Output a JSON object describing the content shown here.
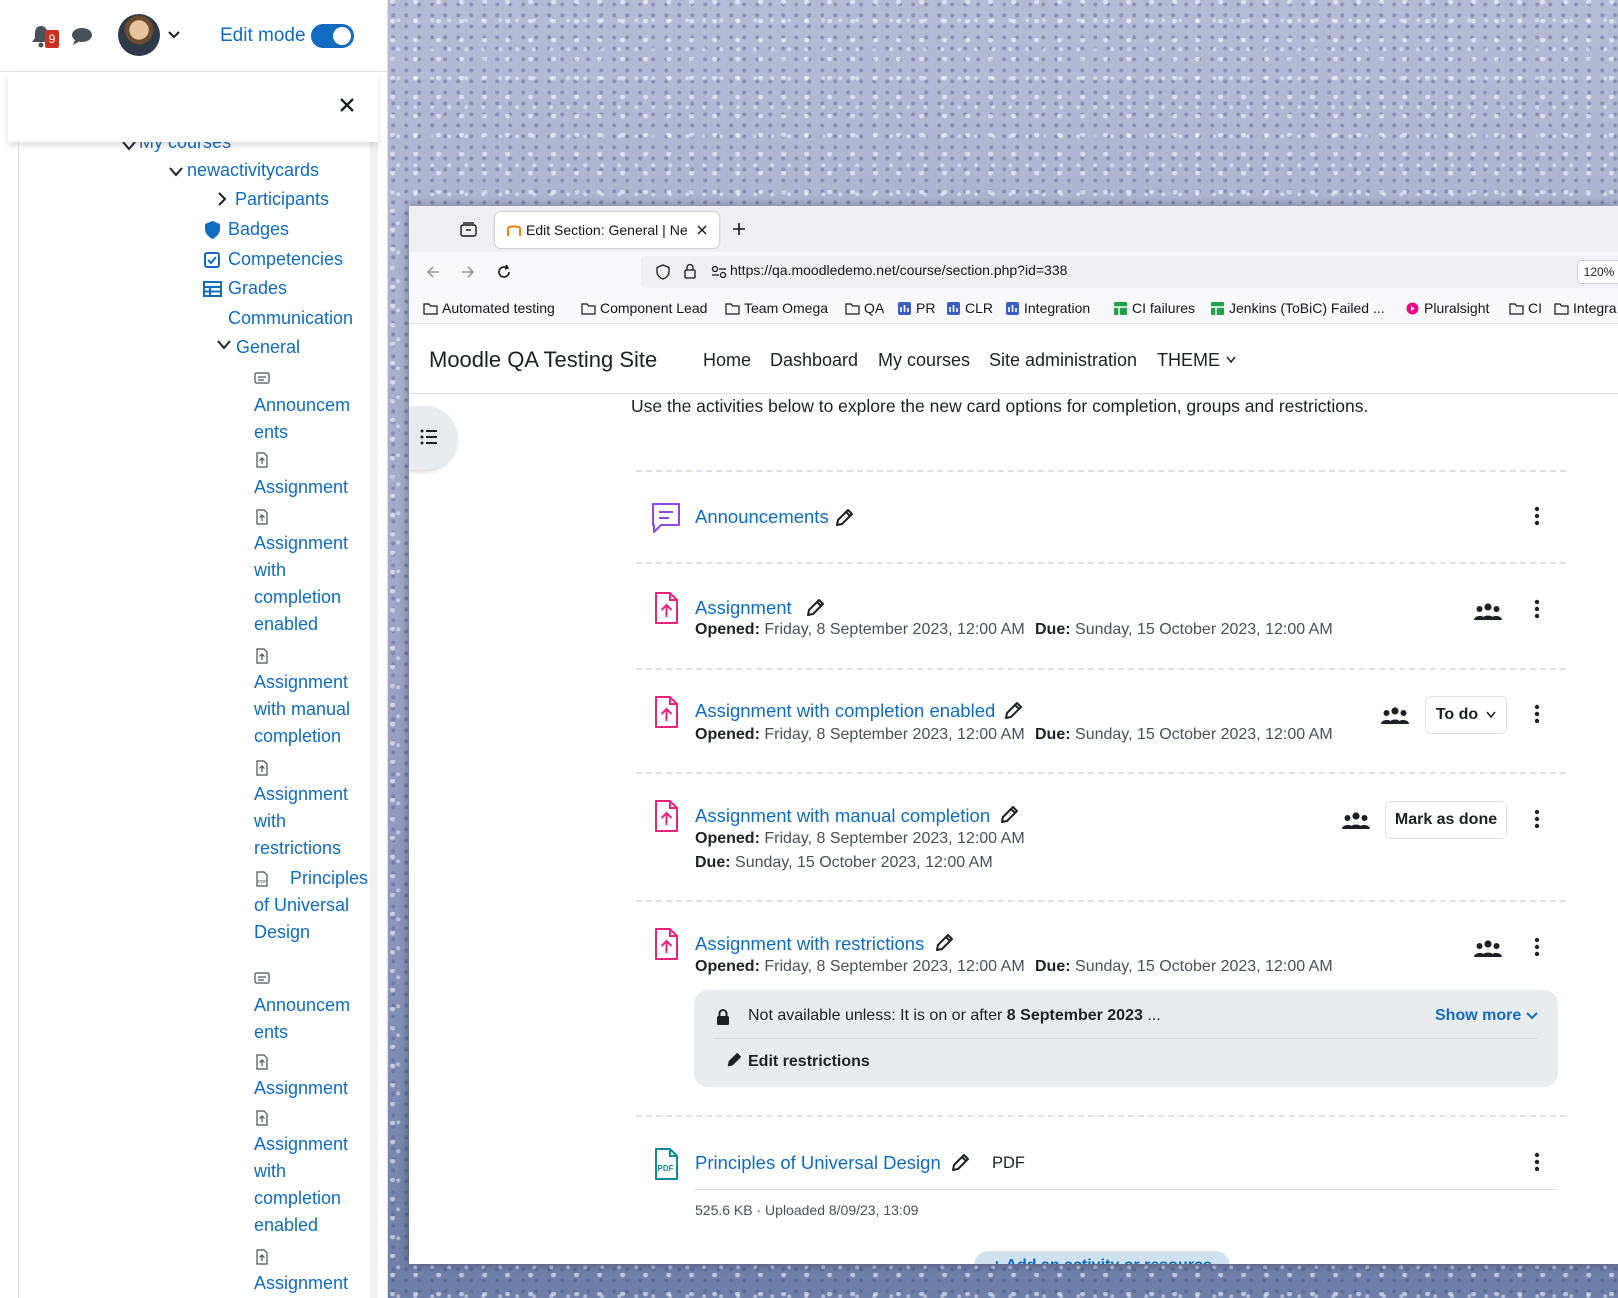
{
  "user_bar": {
    "notification_count": "9",
    "edit_mode_label": "Edit mode",
    "edit_mode_on": true
  },
  "course_index": {
    "my_courses": "My courses",
    "course": "newactivitycards",
    "participants": "Participants",
    "badges": "Badges",
    "competencies": "Competencies",
    "grades": "Grades",
    "communication": "Communication",
    "section_general": "General",
    "items": [
      "Announcem ents",
      "Assignment",
      "Assignment with completion enabled",
      "Assignment with manual completion",
      "Assignment with restrictions",
      "Principles of Universal Design",
      "Announcem ents",
      "Assignment",
      "Assignment with completion enabled",
      "Assignment"
    ]
  },
  "browser": {
    "tab_title": "Edit Section: General | Ne",
    "url": "https://qa.moodledemo.net/course/section.php?id=338",
    "zoom": "120%",
    "bookmarks": [
      "Automated testing",
      "Component Lead",
      "Team Omega",
      "QA",
      "PR",
      "CLR",
      "Integration",
      "CI failures",
      "Jenkins (ToBiC) Failed ...",
      "Pluralsight",
      "CI",
      "Integra"
    ]
  },
  "moodle": {
    "site_name": "Moodle QA Testing Site",
    "menu": [
      "Home",
      "Dashboard",
      "My courses",
      "Site administration",
      "THEME"
    ],
    "intro": "Use the activities below to explore the new card options for completion, groups and restrictions.",
    "labels": {
      "opened": "Opened:",
      "due": "Due:"
    },
    "activities": [
      {
        "title": "Announcements"
      },
      {
        "title": "Assignment",
        "opened": "Friday, 8 September 2023, 12:00 AM",
        "due": "Sunday, 15 October 2023, 12:00 AM"
      },
      {
        "title": "Assignment with completion enabled",
        "opened": "Friday, 8 September 2023, 12:00 AM",
        "due": "Sunday, 15 October 2023, 12:00 AM",
        "completion_button": "To do"
      },
      {
        "title": "Assignment with manual completion",
        "opened": "Friday, 8 September 2023, 12:00 AM",
        "due": "Sunday, 15 October 2023, 12:00 AM",
        "completion_button": "Mark as done"
      },
      {
        "title": "Assignment with restrictions",
        "opened": "Friday, 8 September 2023, 12:00 AM",
        "due": "Sunday, 15 October 2023, 12:00 AM"
      },
      {
        "title": "Principles of Universal Design",
        "type": "PDF",
        "file_meta": "525.6 KB · Uploaded 8/09/23, 13:09"
      }
    ],
    "restriction": {
      "prefix": "Not available unless: It is on or after ",
      "date": "8 September 2023",
      "suffix": " ...",
      "show_more": "Show more",
      "edit": "Edit restrictions"
    },
    "add_activity": "+ Add an activity or resource"
  },
  "colors": {
    "link": "#0f6cbf",
    "assignment_icon": "#e8247a",
    "forum_icon": "#8b49e8",
    "pdf_icon": "#0d8a9e"
  }
}
